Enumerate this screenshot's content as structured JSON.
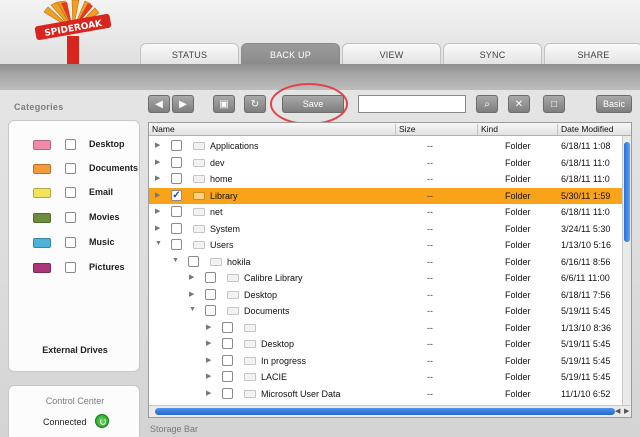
{
  "app": {
    "logo_text": "SPIDEROAK"
  },
  "tabs": [
    {
      "label": "STATUS",
      "active": false
    },
    {
      "label": "BACK UP",
      "active": true
    },
    {
      "label": "VIEW",
      "active": false
    },
    {
      "label": "SYNC",
      "active": false
    },
    {
      "label": "SHARE",
      "active": false
    }
  ],
  "sidebar": {
    "title": "Categories",
    "categories": [
      {
        "label": "Desktop",
        "color": "#f08aa8"
      },
      {
        "label": "Documents",
        "color": "#f5993a"
      },
      {
        "label": "Email",
        "color": "#f3e25b"
      },
      {
        "label": "Movies",
        "color": "#6d8d3e"
      },
      {
        "label": "Music",
        "color": "#4fb3d9"
      },
      {
        "label": "Pictures",
        "color": "#a9377a"
      }
    ],
    "external_drives": "External Drives",
    "control_center": {
      "title": "Control Center",
      "status": "Connected",
      "status_color": "#2fb52f"
    }
  },
  "toolbar": {
    "save_label": "Save",
    "basic_label": "Basic",
    "search_value": "",
    "icons": [
      "back-icon",
      "forward-icon",
      "select-all-icon",
      "refresh-icon",
      "search-icon",
      "clear-icon",
      "stop-icon"
    ]
  },
  "tree": {
    "columns": {
      "name": "Name",
      "size": "Size",
      "kind": "Kind",
      "date": "Date Modified"
    },
    "rows": [
      {
        "name": "Applications",
        "depth": 0,
        "expanded": false,
        "checked": false,
        "size": "--",
        "kind": "Folder",
        "date": "6/18/11 1:08",
        "selected": false
      },
      {
        "name": "dev",
        "depth": 0,
        "expanded": false,
        "checked": false,
        "size": "--",
        "kind": "Folder",
        "date": "6/18/11 11:0",
        "selected": false
      },
      {
        "name": "home",
        "depth": 0,
        "expanded": false,
        "checked": false,
        "size": "--",
        "kind": "Folder",
        "date": "6/18/11 11:0",
        "selected": false
      },
      {
        "name": "Library",
        "depth": 0,
        "expanded": false,
        "checked": true,
        "size": "--",
        "kind": "Folder",
        "date": "5/30/11 1:59",
        "selected": true
      },
      {
        "name": "net",
        "depth": 0,
        "expanded": false,
        "checked": false,
        "size": "--",
        "kind": "Folder",
        "date": "6/18/11 11:0",
        "selected": false
      },
      {
        "name": "System",
        "depth": 0,
        "expanded": false,
        "checked": false,
        "size": "--",
        "kind": "Folder",
        "date": "3/24/11 5:30",
        "selected": false
      },
      {
        "name": "Users",
        "depth": 0,
        "expanded": true,
        "checked": false,
        "size": "--",
        "kind": "Folder",
        "date": "1/13/10 5:16",
        "selected": false
      },
      {
        "name": "hokila",
        "depth": 1,
        "expanded": true,
        "checked": false,
        "size": "--",
        "kind": "Folder",
        "date": "6/16/11 8:56",
        "selected": false
      },
      {
        "name": "Calibre Library",
        "depth": 2,
        "expanded": false,
        "checked": false,
        "size": "--",
        "kind": "Folder",
        "date": "6/6/11 11:00",
        "selected": false
      },
      {
        "name": "Desktop",
        "depth": 2,
        "expanded": false,
        "checked": false,
        "size": "--",
        "kind": "Folder",
        "date": "6/18/11 7:56",
        "selected": false
      },
      {
        "name": "Documents",
        "depth": 2,
        "expanded": true,
        "checked": false,
        "size": "--",
        "kind": "Folder",
        "date": "5/19/11 5:45",
        "selected": false
      },
      {
        "name": "",
        "depth": 3,
        "expanded": false,
        "checked": false,
        "size": "--",
        "kind": "Folder",
        "date": "1/13/10 8:36",
        "selected": false
      },
      {
        "name": "Desktop",
        "depth": 3,
        "expanded": false,
        "checked": false,
        "size": "--",
        "kind": "Folder",
        "date": "5/19/11 5:45",
        "selected": false
      },
      {
        "name": "In progress",
        "depth": 3,
        "expanded": false,
        "checked": false,
        "size": "--",
        "kind": "Folder",
        "date": "5/19/11 5:45",
        "selected": false
      },
      {
        "name": "LACIE",
        "depth": 3,
        "expanded": false,
        "checked": false,
        "size": "--",
        "kind": "Folder",
        "date": "5/19/11 5:45",
        "selected": false
      },
      {
        "name": "Microsoft User Data",
        "depth": 3,
        "expanded": false,
        "checked": false,
        "size": "--",
        "kind": "Folder",
        "date": "11/1/10 6:52",
        "selected": false
      }
    ]
  },
  "storage_bar": {
    "label": "Storage Bar"
  }
}
